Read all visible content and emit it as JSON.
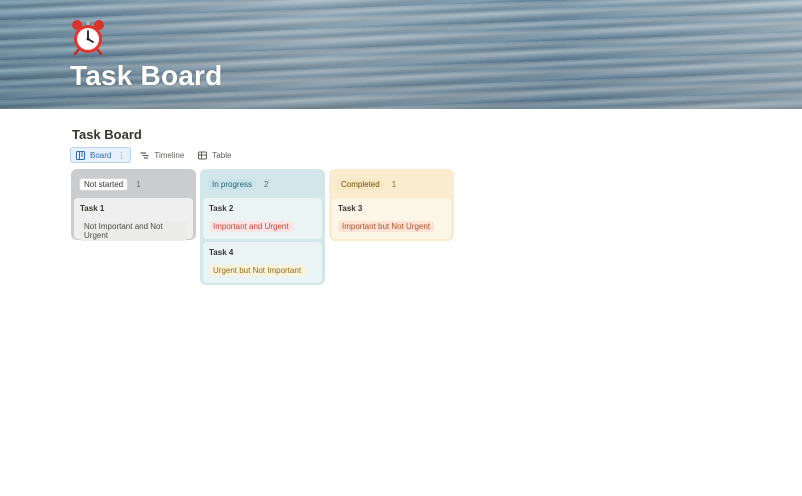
{
  "page": {
    "icon": "alarm-clock-icon",
    "title": "Task Board"
  },
  "database": {
    "title": "Task Board",
    "views": [
      {
        "label": "Board",
        "icon": "board-icon",
        "active": true
      },
      {
        "label": "Timeline",
        "icon": "timeline-icon",
        "active": false
      },
      {
        "label": "Table",
        "icon": "table-icon",
        "active": false
      }
    ]
  },
  "board": {
    "columns": [
      {
        "label": "Not started",
        "count": "1",
        "color": "#cbccce",
        "cards": [
          {
            "title": "Task 1",
            "tag": "Not Important and Not Urgent"
          }
        ]
      },
      {
        "label": "In progress",
        "count": "2",
        "color": "#d3e6ea",
        "cards": [
          {
            "title": "Task 2",
            "tag": "Important and Urgent"
          },
          {
            "title": "Task 4",
            "tag": "Urgent but Not Important"
          }
        ]
      },
      {
        "label": "Completed",
        "count": "1",
        "color": "#faedcf",
        "cards": [
          {
            "title": "Task 3",
            "tag": "Important but Not Urgent"
          }
        ]
      }
    ]
  }
}
